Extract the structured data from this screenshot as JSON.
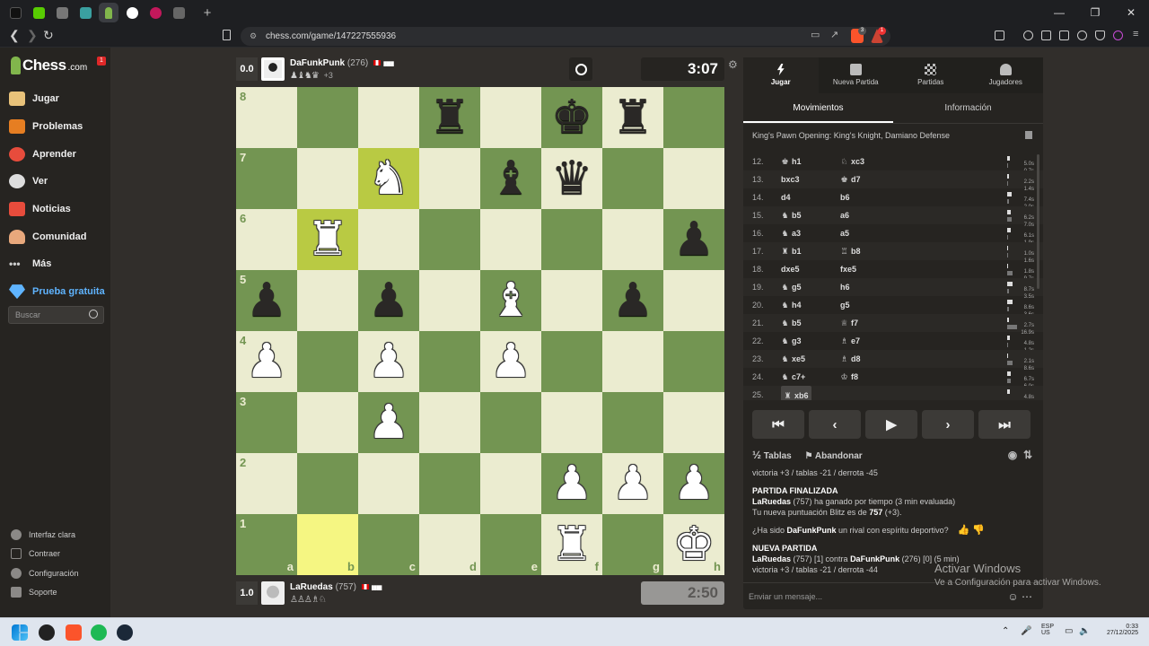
{
  "browser": {
    "url": "chess.com/game/147227555936",
    "tab_add": "+",
    "window_controls": [
      "—",
      "❐",
      "✕"
    ],
    "brave_badge": "3",
    "alert_badge": "1"
  },
  "sidebar": {
    "logo_main": "Chess",
    "logo_suffix": ".com",
    "notification_count": "1",
    "items": [
      {
        "label": "Jugar",
        "icon": "play-icon",
        "color": "#e8c27a"
      },
      {
        "label": "Problemas",
        "icon": "puzzle-icon",
        "color": "#e67e22"
      },
      {
        "label": "Aprender",
        "icon": "learn-icon",
        "color": "#e74c3c"
      },
      {
        "label": "Ver",
        "icon": "watch-icon",
        "color": "#dddddd"
      },
      {
        "label": "Noticias",
        "icon": "news-icon",
        "color": "#e74c3c"
      },
      {
        "label": "Comunidad",
        "icon": "community-icon",
        "color": "#e8a87c"
      },
      {
        "label": "Más",
        "icon": "more-icon",
        "color": "#cccccc"
      },
      {
        "label": "Prueba gratuita",
        "icon": "diamond-icon",
        "color": "#5fb4ff"
      }
    ],
    "search_placeholder": "Buscar",
    "bottom_items": [
      {
        "label": "Interfaz clara",
        "icon": "theme-icon"
      },
      {
        "label": "Contraer",
        "icon": "collapse-icon"
      },
      {
        "label": "Configuración",
        "icon": "settings-icon"
      },
      {
        "label": "Soporte",
        "icon": "help-icon"
      }
    ]
  },
  "top_player": {
    "score": "0.0",
    "name": "DaFunkPunk",
    "rating": "(276)",
    "bars": "▮▮▮▮",
    "captured": "♟♝♞♛",
    "advantage": "+3",
    "clock": "3:07"
  },
  "bottom_player": {
    "score": "1.0",
    "name": "LaRuedas",
    "rating": "(757)",
    "bars": "▮▮▮▮",
    "captured": "♙♙♙♗♘",
    "clock": "2:50"
  },
  "board": {
    "ranks": [
      "8",
      "7",
      "6",
      "5",
      "4",
      "3",
      "2",
      "1"
    ],
    "files": [
      "a",
      "b",
      "c",
      "d",
      "e",
      "f",
      "g",
      "h"
    ],
    "highlights": [
      "c7",
      "b6",
      "b1"
    ],
    "pieces": {
      "d8": "bR",
      "f8": "bK",
      "g8": "bR",
      "c7": "wN",
      "e7": "bB",
      "f7": "bQ",
      "b6": "wR",
      "h6": "bP",
      "a5": "bP",
      "c5": "bP",
      "e5": "wB",
      "g5": "bP",
      "a4": "wP",
      "c4": "wP",
      "e4": "wP",
      "c3": "wP",
      "f2": "wP",
      "g2": "wP",
      "h2": "wP",
      "f1": "wR",
      "h1": "wK"
    }
  },
  "panel": {
    "tabs": [
      {
        "label": "Jugar",
        "icon": "bolt-icon"
      },
      {
        "label": "Nueva Partida",
        "icon": "plus-icon"
      },
      {
        "label": "Partidas",
        "icon": "games-icon"
      },
      {
        "label": "Jugadores",
        "icon": "players-icon"
      }
    ],
    "subtabs": [
      "Movimientos",
      "Información"
    ],
    "opening": "King's Pawn Opening: King's Knight, Damiano Defense",
    "moves": [
      {
        "no": "12.",
        "wp": "♚",
        "w": "h1",
        "bp": "♘",
        "b": "xc3",
        "t1": "5.0s",
        "t2": "0.7s",
        "p1": 0.2,
        "p2": 0.05
      },
      {
        "no": "13.",
        "wp": "",
        "w": "bxc3",
        "bp": "♚",
        "b": "d7",
        "t1": "2.2s",
        "t2": "1.4s",
        "p1": 0.1,
        "p2": 0.08
      },
      {
        "no": "14.",
        "wp": "",
        "w": "d4",
        "bp": "",
        "b": "b6",
        "t1": "7.4s",
        "t2": "2.0s",
        "p1": 0.3,
        "p2": 0.1
      },
      {
        "no": "15.",
        "wp": "♞",
        "w": "b5",
        "bp": "",
        "b": "a6",
        "t1": "6.2s",
        "t2": "7.0s",
        "p1": 0.25,
        "p2": 0.3
      },
      {
        "no": "16.",
        "wp": "♞",
        "w": "a3",
        "bp": "",
        "b": "a5",
        "t1": "6.1s",
        "t2": "1.9s",
        "p1": 0.25,
        "p2": 0.08
      },
      {
        "no": "17.",
        "wp": "♜",
        "w": "b1",
        "bp": "♖",
        "b": "b8",
        "t1": "1.0s",
        "t2": "1.6s",
        "p1": 0.05,
        "p2": 0.07
      },
      {
        "no": "18.",
        "wp": "",
        "w": "dxe5",
        "bp": "",
        "b": "fxe5",
        "t1": "1.8s",
        "t2": "9.7s",
        "p1": 0.08,
        "p2": 0.4
      },
      {
        "no": "19.",
        "wp": "♞",
        "w": "g5",
        "bp": "",
        "b": "h6",
        "t1": "8.7s",
        "t2": "3.5s",
        "p1": 0.35,
        "p2": 0.15
      },
      {
        "no": "20.",
        "wp": "♞",
        "w": "h4",
        "bp": "",
        "b": "g5",
        "t1": "8.6s",
        "t2": "3.6s",
        "p1": 0.35,
        "p2": 0.15
      },
      {
        "no": "21.",
        "wp": "♞",
        "w": "b5",
        "bp": "♕",
        "b": "f7",
        "t1": "2.7s",
        "t2": "16.9s",
        "p1": 0.1,
        "p2": 0.7
      },
      {
        "no": "22.",
        "wp": "♞",
        "w": "g3",
        "bp": "♗",
        "b": "e7",
        "t1": "4.8s",
        "t2": "1.2s",
        "p1": 0.2,
        "p2": 0.05
      },
      {
        "no": "23.",
        "wp": "♞",
        "w": "xe5",
        "bp": "♗",
        "b": "d8",
        "t1": "2.1s",
        "t2": "8.6s",
        "p1": 0.08,
        "p2": 0.35
      },
      {
        "no": "24.",
        "wp": "♞",
        "w": "c7+",
        "bp": "♔",
        "b": "f8",
        "t1": "6.7s",
        "t2": "6.0s",
        "p1": 0.28,
        "p2": 0.25
      },
      {
        "no": "25.",
        "wp": "♜",
        "w": "xb6",
        "bp": "",
        "b": "",
        "t1": "4.8s",
        "t2": "",
        "p1": 0.2,
        "p2": 0
      }
    ],
    "controls": [
      "⏮",
      "‹",
      "▶",
      "›",
      "⏭"
    ],
    "draw_label": "Tablas",
    "draw_icon_text": "½",
    "resign_label": "Abandonar",
    "chat": {
      "line0": "victoria +3 / tablas -21 / derrota -45",
      "h1": "PARTIDA FINALIZADA",
      "l1_name": "LaRuedas",
      "l1_rest": " (757) ha ganado por tiempo (3 min evaluada)",
      "l2_pre": "Tu nueva puntuación Blitz es de ",
      "l2_val": "757",
      "l2_post": " (+3).",
      "q_pre": "¿Ha sido ",
      "q_name": "DaFunkPunk",
      "q_post": " un rival con espíritu deportivo?",
      "h2": "NUEVA PARTIDA",
      "np_name1": "LaRuedas",
      "np_mid": " (757) [1] contra ",
      "np_name2": "DaFunkPunk",
      "np_post": " (276) [0] (5 min)",
      "line_last": "victoria +3 / tablas -21 / derrota -44"
    },
    "chat_placeholder": "Enviar un mensaje..."
  },
  "watermark": {
    "title": "Activar Windows",
    "subtitle": "Ve a Configuración para activar Windows."
  },
  "taskbar": {
    "lang1": "ESP",
    "lang2": "US",
    "time": "0:33",
    "date": "27/12/2025"
  }
}
